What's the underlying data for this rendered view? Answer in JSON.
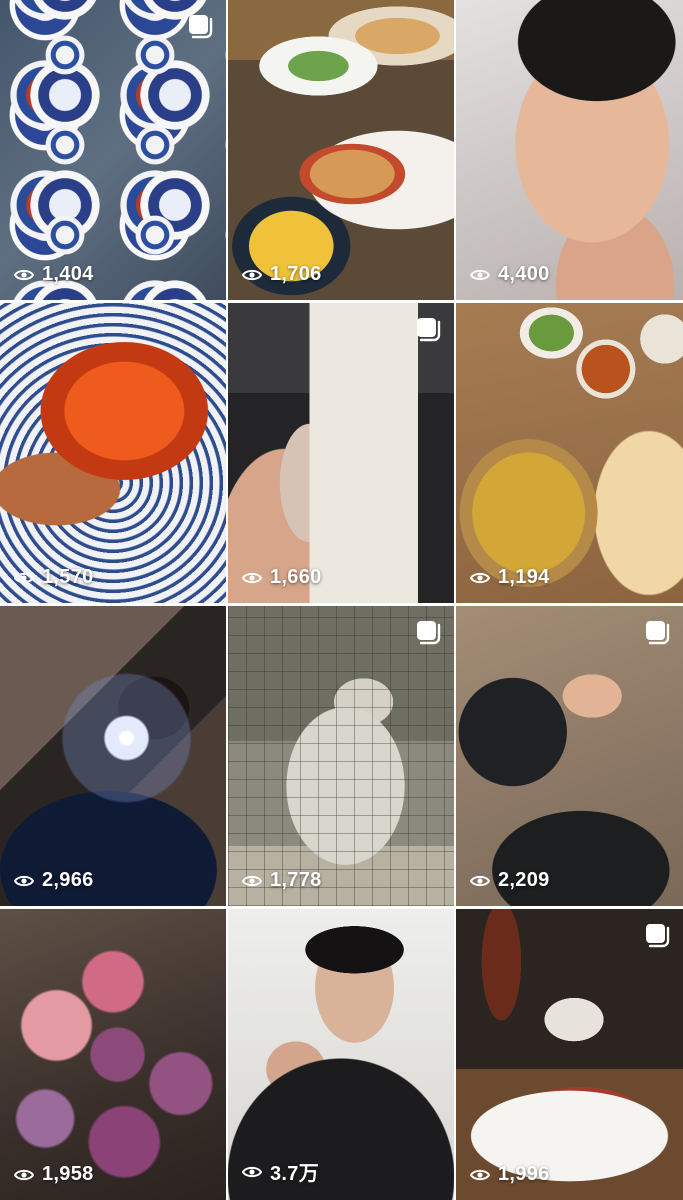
{
  "grid": {
    "items": [
      {
        "image": "blue-and-white-plates",
        "views": "1,404",
        "multi": true
      },
      {
        "image": "food-spread-on-table",
        "views": "1,706",
        "multi": false
      },
      {
        "image": "man-selfie-with-earbud",
        "views": "4,400",
        "multi": false
      },
      {
        "image": "salmon-roe-rice-bowl",
        "views": "1,570",
        "multi": false
      },
      {
        "image": "lay-figure-perfume-box",
        "views": "1,660",
        "multi": true
      },
      {
        "image": "curry-and-naan-set",
        "views": "1,194",
        "multi": false
      },
      {
        "image": "flash-mirror-selfie",
        "views": "2,966",
        "multi": false
      },
      {
        "image": "snow-leopard-behind-fence",
        "views": "1,778",
        "multi": true
      },
      {
        "image": "peace-sign-hand",
        "views": "2,209",
        "multi": true
      },
      {
        "image": "rose-bouquet",
        "views": "1,958",
        "multi": false
      },
      {
        "image": "mirror-selfie-phone",
        "views": "3.7万",
        "multi": false
      },
      {
        "image": "duck-breast-plate",
        "views": "1,996",
        "multi": true
      }
    ]
  },
  "icons": {
    "views": "eye-icon",
    "multi": "multiple-posts-icon"
  },
  "colors": {
    "overlay_text": "#ffffff",
    "background": "#ffffff"
  }
}
